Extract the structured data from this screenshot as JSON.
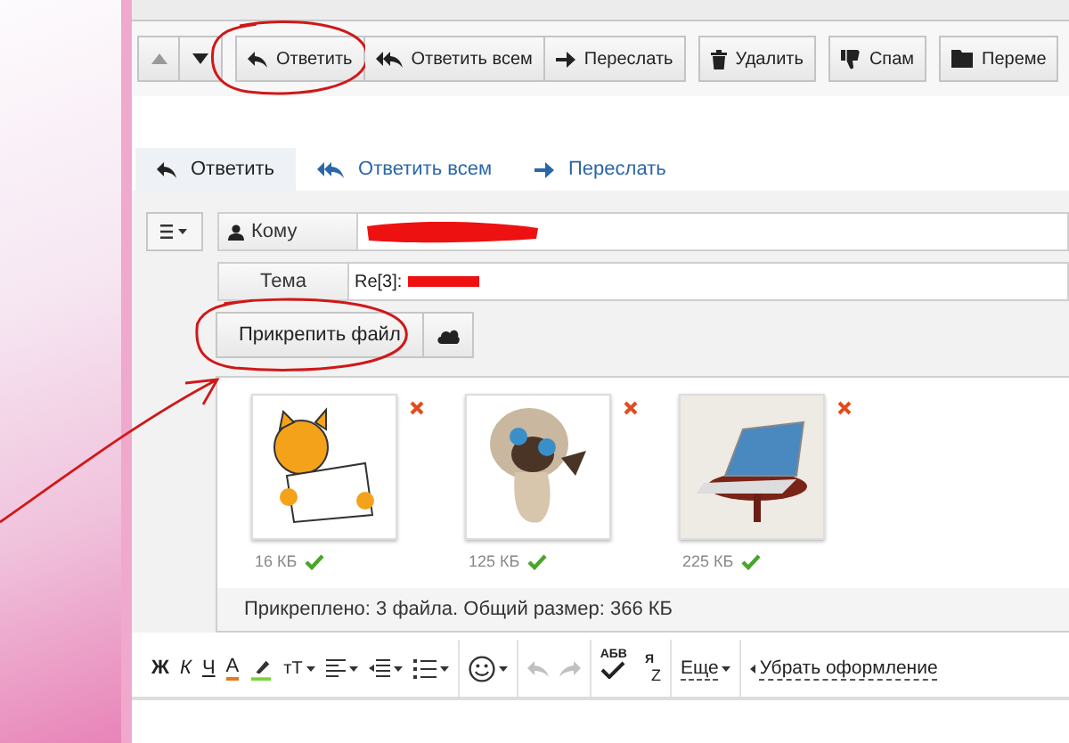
{
  "nav": [
    {
      "kind": "up",
      "disabled": true
    },
    {
      "kind": "down",
      "disabled": false
    }
  ],
  "toolbar": [
    {
      "buttons": [
        {
          "kind": "reply",
          "label": "Ответить",
          "circled": true
        },
        {
          "kind": "reply-all",
          "label": "Ответить всем",
          "circled": false
        },
        {
          "kind": "forward",
          "label": "Переслать",
          "circled": false
        }
      ]
    },
    {
      "buttons": [
        {
          "kind": "trash",
          "label": "Удалить",
          "circled": false
        }
      ]
    },
    {
      "buttons": [
        {
          "kind": "thumbs-down",
          "label": "Спам",
          "circled": false
        }
      ]
    },
    {
      "buttons": [
        {
          "kind": "folder",
          "label": "Переме",
          "circled": false
        }
      ]
    }
  ],
  "tabs": [
    {
      "kind": "reply",
      "label": "Ответить",
      "selected": true
    },
    {
      "kind": "reply-all",
      "label": "Ответить всем",
      "selected": false
    },
    {
      "kind": "forward",
      "label": "Переслать",
      "selected": false
    }
  ],
  "recipient": {
    "label": "Кому",
    "redacted": true
  },
  "subject": {
    "label": "Тема",
    "value": "Re[3]:",
    "redacted": true
  },
  "attach_button": {
    "label": "Прикрепить файл",
    "circled": true
  },
  "annotation_arrow": true,
  "attachments": [
    {
      "kind": "cat-letter",
      "size": "16 КБ",
      "uploaded": true
    },
    {
      "kind": "kitten",
      "size": "125 КБ",
      "uploaded": true
    },
    {
      "kind": "laptop",
      "size": "225 КБ",
      "uploaded": true
    }
  ],
  "attachments_summary": "Прикреплено: 3 файла. Общий размер: 366 КБ",
  "format_tool_groups": [
    {
      "tools": [
        {
          "kind": "bold",
          "label": "Ж",
          "disabled": false
        },
        {
          "kind": "italic",
          "label": "К",
          "disabled": false
        },
        {
          "kind": "underline",
          "label": "Ч",
          "disabled": false
        },
        {
          "kind": "color",
          "label": "A",
          "disabled": false
        },
        {
          "kind": "highlight",
          "disabled": false
        },
        {
          "kind": "size",
          "label": "тТ",
          "disabled": false
        },
        {
          "kind": "align",
          "disabled": false
        },
        {
          "kind": "indent",
          "disabled": false
        },
        {
          "kind": "list",
          "disabled": false
        }
      ]
    },
    {
      "tools": [
        {
          "kind": "smiley",
          "disabled": false
        }
      ]
    },
    {
      "tools": [
        {
          "kind": "undo",
          "disabled": true
        },
        {
          "kind": "redo",
          "disabled": true
        }
      ]
    },
    {
      "tools": [
        {
          "kind": "spell",
          "label": "АБВ",
          "disabled": false
        },
        {
          "kind": "translit",
          "label": "Я",
          "label2": "Z",
          "disabled": false
        }
      ]
    },
    {
      "tools": [
        {
          "kind": "more",
          "label": "Еще",
          "disabled": false
        }
      ]
    },
    {
      "tools": [
        {
          "kind": "clear",
          "label": "Убрать оформление",
          "disabled": false
        }
      ]
    }
  ]
}
